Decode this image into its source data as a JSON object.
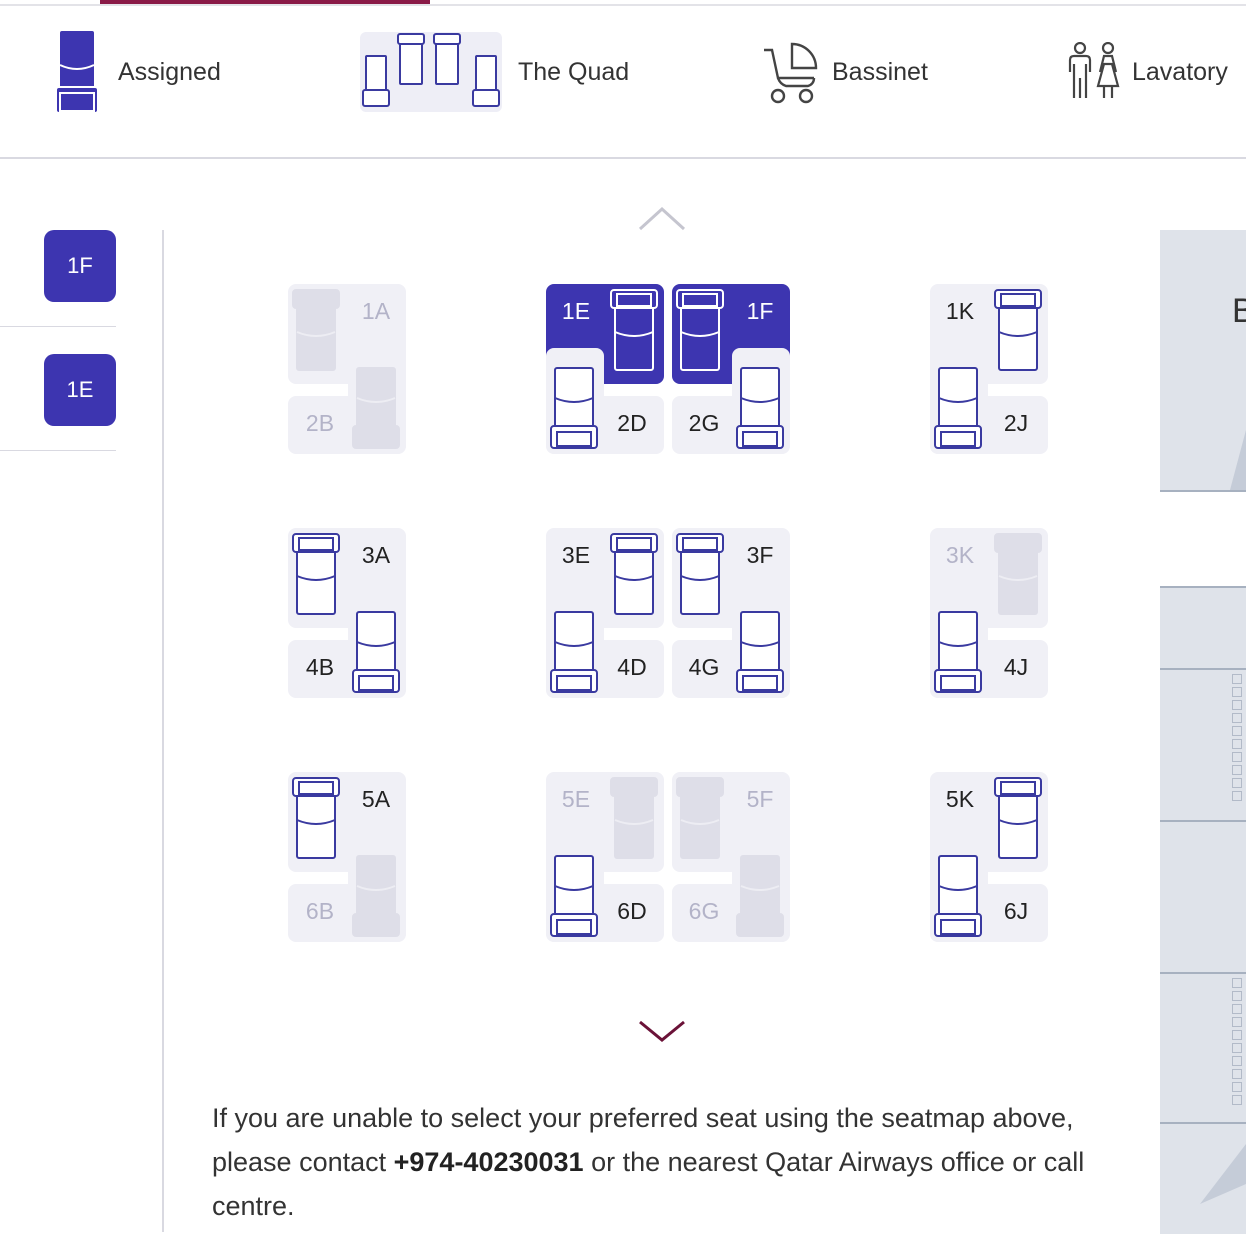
{
  "legend": {
    "assigned": "Assigned",
    "quad": "The Quad",
    "bassinet": "Bassinet",
    "lavatory": "Lavatory"
  },
  "side": {
    "badge1": "1F",
    "badge2": "1E"
  },
  "seats": {
    "s1A": "1A",
    "s2B": "2B",
    "s1E": "1E",
    "s1F": "1F",
    "s2D": "2D",
    "s2G": "2G",
    "s1K": "1K",
    "s2J": "2J",
    "s3A": "3A",
    "s4B": "4B",
    "s3E": "3E",
    "s3F": "3F",
    "s4D": "4D",
    "s4G": "4G",
    "s3K": "3K",
    "s4J": "4J",
    "s5A": "5A",
    "s6B": "6B",
    "s5E": "5E",
    "s5F": "5F",
    "s6D": "6D",
    "s6G": "6G",
    "s5K": "5K",
    "s6J": "6J"
  },
  "note": {
    "before": "If you are unable to select your preferred seat using the seatmap above, please contact ",
    "phone": "+974-40230031",
    "after": " or the nearest Qatar Airways office or call centre."
  },
  "right_panel": {
    "letter": "B"
  },
  "colors": {
    "selected": "#3d35b0",
    "outline": "#3a3aa0",
    "accent": "#8a1b47"
  }
}
